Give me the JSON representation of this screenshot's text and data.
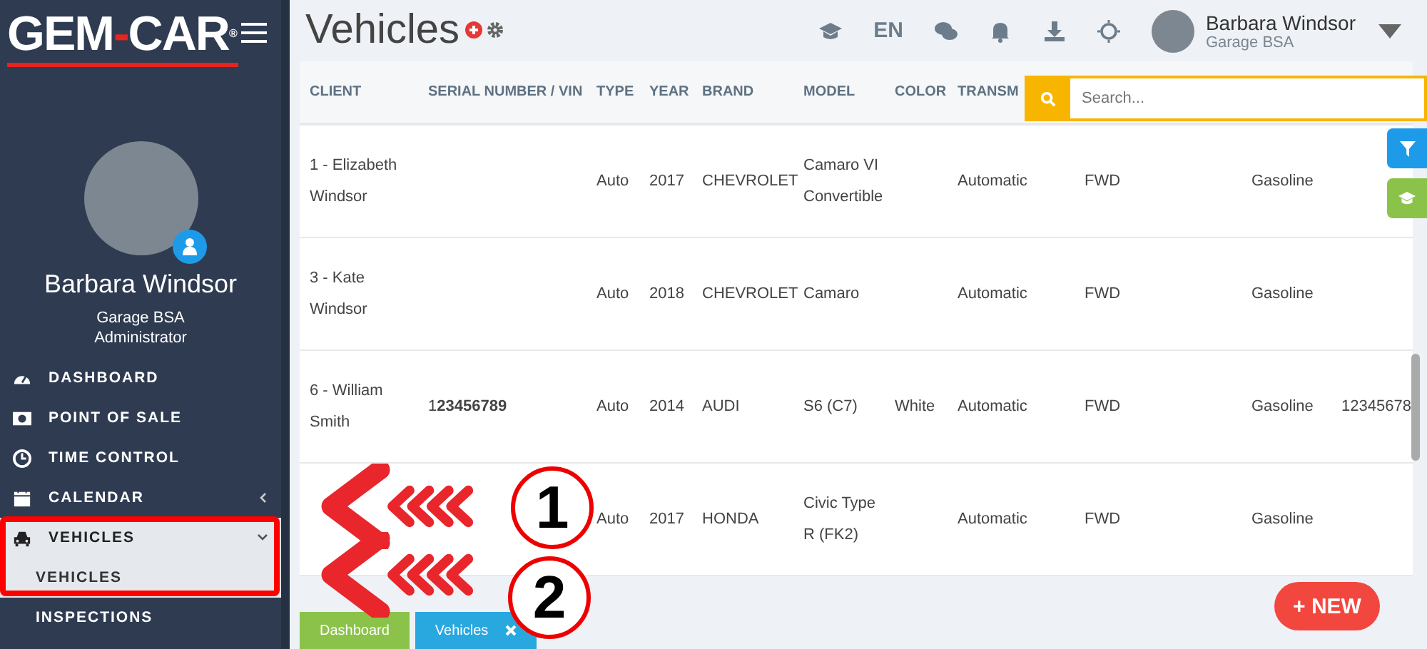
{
  "sidebar": {
    "logo": {
      "left": "GEM",
      "dash": "-",
      "right": "CAR",
      "mark": "®"
    },
    "user": {
      "name": "Barbara Windsor",
      "company": "Garage BSA",
      "role": "Administrator"
    },
    "items": [
      {
        "kind": "link",
        "label": "DASHBOARD",
        "selected": false
      },
      {
        "kind": "link",
        "label": "POINT OF SALE",
        "selected": false
      },
      {
        "kind": "link",
        "label": "TIME CONTROL",
        "selected": false
      },
      {
        "kind": "group",
        "label": "CALENDAR",
        "selected": false,
        "expanded": false
      },
      {
        "kind": "group",
        "label": "VEHICLES",
        "selected": true,
        "expanded": true,
        "children": [
          {
            "label": "VEHICLES",
            "selected": true
          },
          {
            "label": "INSPECTIONS",
            "selected": false
          }
        ]
      }
    ]
  },
  "header": {
    "title": "Vehicles",
    "language": "EN",
    "user": {
      "name": "Barbara Windsor",
      "company": "Garage BSA"
    }
  },
  "search": {
    "placeholder": "Search..."
  },
  "table": {
    "columns": [
      "CLIENT",
      "SERIAL NUMBER / VIN",
      "TYPE",
      "YEAR",
      "BRAND",
      "MODEL",
      "COLOR",
      "TRANSM"
    ],
    "rows": [
      {
        "cells": [
          "1 - Elizabeth Windsor",
          "",
          "Auto",
          "2017",
          "CHEVROLET",
          "Camaro VI Convertible",
          "",
          "Automatic",
          "FWD",
          "Gasoline",
          ""
        ]
      },
      {
        "cells": [
          "3 - Kate Windsor",
          "",
          "Auto",
          "2018",
          "CHEVROLET",
          "Camaro",
          "",
          "Automatic",
          "FWD",
          "Gasoline",
          ""
        ]
      },
      {
        "cells": [
          "6 - William Smith",
          "1**23456789**",
          "Auto",
          "2014",
          "AUDI",
          "S6 (C7)",
          "White",
          "Automatic",
          "FWD",
          "Gasoline",
          "12345678"
        ]
      },
      {
        "cells": [
          "",
          "",
          "Auto",
          "2017",
          "HONDA",
          "Civic Type R (FK2)",
          "",
          "Automatic",
          "FWD",
          "Gasoline",
          ""
        ]
      }
    ]
  },
  "new_button": "+ NEW",
  "open_tabs": [
    {
      "label": "Dashboard",
      "color": "#8bc34a",
      "closable": false
    },
    {
      "label": "Vehicles",
      "color": "#29a8e0",
      "closable": true
    }
  ],
  "annotations": [
    {
      "number": "1"
    },
    {
      "number": "2"
    }
  ]
}
